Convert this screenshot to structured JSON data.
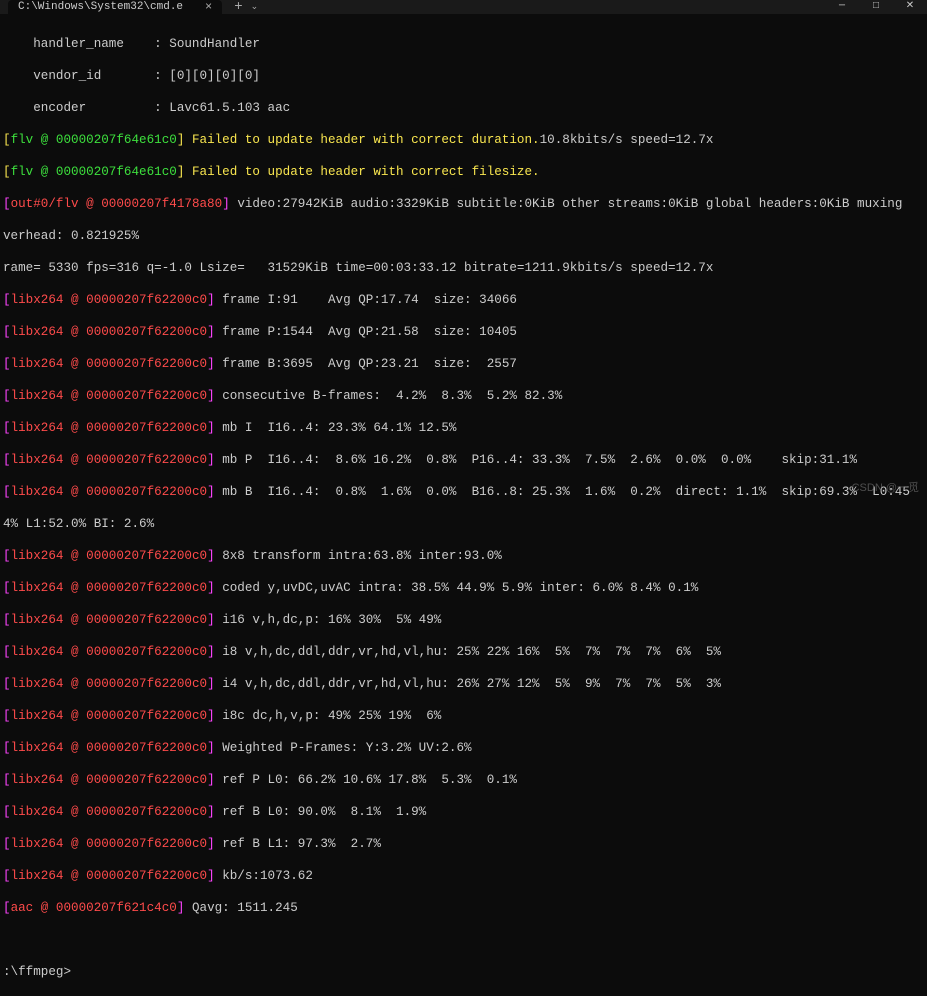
{
  "title": "C:\\Windows\\System32\\cmd.e",
  "watermark": "CSDN @一觅",
  "meta": {
    "handler_name": "    handler_name    : SoundHandler",
    "vendor_id": "    vendor_id       : [0][0][0][0]",
    "encoder": "    encoder         : Lavc61.5.103 aac"
  },
  "flv_tag1": "flv @ 00000207f64e61c0",
  "flv_tag2": "flv @ 00000207f64e61c0",
  "flv_msg1a": "Failed to update header with correct duration.",
  "flv_msg1b": "10.8kbits/s speed=12.7x",
  "flv_msg2": "Failed to update header with correct filesize.",
  "out_tag": "out#0/flv @ 00000207f4178a80",
  "out_msg": "video:27942KiB audio:3329KiB subtitle:0KiB other streams:0KiB global headers:0KiB muxing",
  "overhead": "verhead: 0.821925%",
  "frame_line": "rame= 5330 fps=316 q=-1.0 Lsize=   31529KiB time=00:03:33.12 bitrate=1211.9kbits/s speed=12.7x",
  "x264_tag": "libx264 @ 00000207f62200c0",
  "x264": {
    "l1": "frame I:91    Avg QP:17.74  size: 34066",
    "l2": "frame P:1544  Avg QP:21.58  size: 10405",
    "l3": "frame B:3695  Avg QP:23.21  size:  2557",
    "l4": "consecutive B-frames:  4.2%  8.3%  5.2% 82.3%",
    "l5": "mb I  I16..4: 23.3% 64.1% 12.5%",
    "l6": "mb P  I16..4:  8.6% 16.2%  0.8%  P16..4: 33.3%  7.5%  2.6%  0.0%  0.0%    skip:31.1%",
    "l7": "mb B  I16..4:  0.8%  1.6%  0.0%  B16..8: 25.3%  1.6%  0.2%  direct: 1.1%  skip:69.3%  L0:45",
    "l7b": "4% L1:52.0% BI: 2.6%",
    "l8": "8x8 transform intra:63.8% inter:93.0%",
    "l9": "coded y,uvDC,uvAC intra: 38.5% 44.9% 5.9% inter: 6.0% 8.4% 0.1%",
    "l10": "i16 v,h,dc,p: 16% 30%  5% 49%",
    "l11": "i8 v,h,dc,ddl,ddr,vr,hd,vl,hu: 25% 22% 16%  5%  7%  7%  7%  6%  5%",
    "l12": "i4 v,h,dc,ddl,ddr,vr,hd,vl,hu: 26% 27% 12%  5%  9%  7%  7%  5%  3%",
    "l13": "i8c dc,h,v,p: 49% 25% 19%  6%",
    "l14": "Weighted P-Frames: Y:3.2% UV:2.6%",
    "l15": "ref P L0: 66.2% 10.6% 17.8%  5.3%  0.1%",
    "l16": "ref B L0: 90.0%  8.1%  1.9%",
    "l17": "ref B L1: 97.3%  2.7%",
    "l18": "kb/s:1073.62"
  },
  "aac_tag": "aac @ 00000207f621c4c0",
  "aac_msg": "Qavg: 1511.245",
  "prompt": ":\\ffmpeg>"
}
